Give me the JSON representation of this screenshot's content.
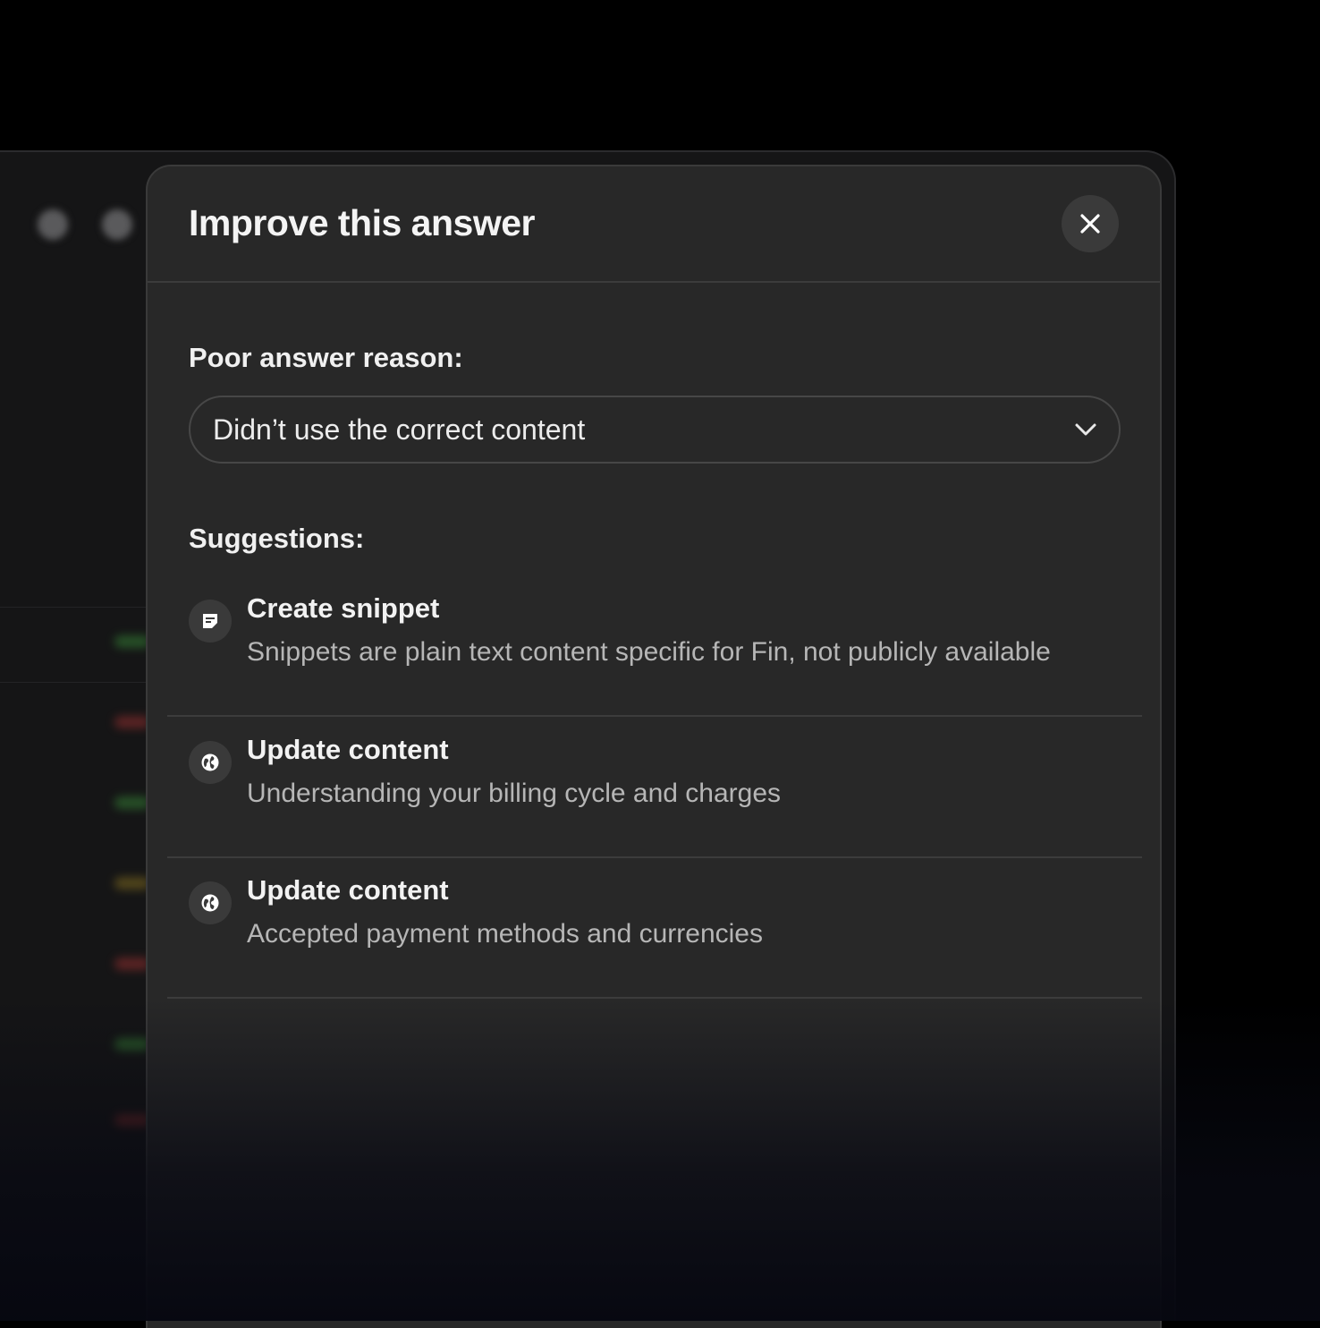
{
  "modal": {
    "title": "Improve this answer",
    "close_icon": "close-icon"
  },
  "reason": {
    "label": "Poor answer reason:",
    "selected": "Didn’t use the correct content",
    "dropdown_icon": "chevron-down-icon"
  },
  "suggestions": {
    "label": "Suggestions:",
    "items": [
      {
        "icon": "snippet-icon",
        "title": "Create snippet",
        "description": "Snippets are plain text content specific for Fin, not publicly available"
      },
      {
        "icon": "globe-icon",
        "title": "Update content",
        "description": "Understanding your billing cycle and charges"
      },
      {
        "icon": "globe-icon",
        "title": "Update content",
        "description": "Accepted payment methods and currencies"
      }
    ]
  },
  "colors": {
    "page_background": "#000000",
    "modal_background": "#282828",
    "divider": "#3c3c3c",
    "text_primary": "#f2f2f2",
    "text_secondary": "#b6b6b6"
  }
}
